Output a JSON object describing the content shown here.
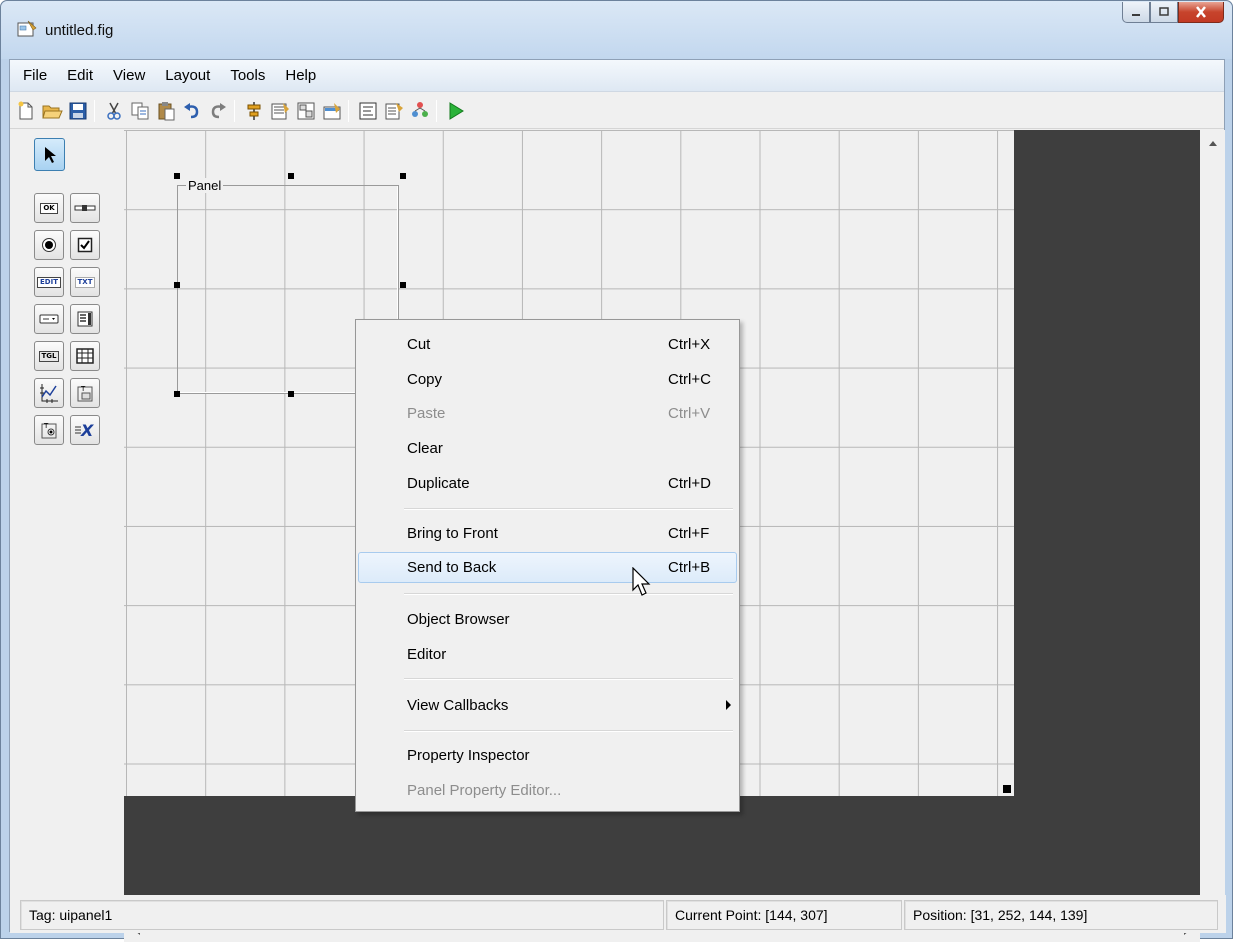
{
  "window": {
    "title": "untitled.fig",
    "controls": [
      "minimize-icon",
      "maximize-icon",
      "close-icon"
    ]
  },
  "menubar": {
    "items": [
      {
        "label": "File"
      },
      {
        "label": "Edit"
      },
      {
        "label": "View"
      },
      {
        "label": "Layout"
      },
      {
        "label": "Tools"
      },
      {
        "label": "Help"
      }
    ]
  },
  "toolbar": {
    "icons": [
      "new-figure-icon",
      "open-icon",
      "save-icon",
      "cut-icon",
      "copy-icon",
      "paste-icon",
      "undo-icon",
      "redo-icon",
      "align-objects-icon",
      "menu-editor-icon",
      "tab-order-editor-icon",
      "toolbar-editor-icon",
      "editor-icon",
      "property-inspector-icon",
      "object-browser-icon",
      "run-figure-icon"
    ]
  },
  "palette": {
    "items": [
      {
        "name": "select-tool",
        "icon": "arrow-pointer-icon",
        "text": ""
      },
      {
        "name": "push-button-tool",
        "icon": "push-button-icon",
        "text": "OK"
      },
      {
        "name": "slider-tool",
        "icon": "slider-icon",
        "text": ""
      },
      {
        "name": "radio-button-tool",
        "icon": "radio-button-icon",
        "text": ""
      },
      {
        "name": "check-box-tool",
        "icon": "check-box-icon",
        "text": ""
      },
      {
        "name": "edit-text-tool",
        "icon": "edit-text-icon",
        "text": "EDIT"
      },
      {
        "name": "static-text-tool",
        "icon": "static-text-icon",
        "text": "TXT"
      },
      {
        "name": "pop-up-menu-tool",
        "icon": "popup-menu-icon",
        "text": ""
      },
      {
        "name": "list-box-tool",
        "icon": "list-box-icon",
        "text": ""
      },
      {
        "name": "toggle-button-tool",
        "icon": "toggle-button-icon",
        "text": "TGL"
      },
      {
        "name": "table-tool",
        "icon": "table-icon",
        "text": ""
      },
      {
        "name": "axes-tool",
        "icon": "axes-icon",
        "text": ""
      },
      {
        "name": "panel-tool",
        "icon": "panel-icon",
        "text": ""
      },
      {
        "name": "button-group-tool",
        "icon": "button-group-icon",
        "text": ""
      },
      {
        "name": "activex-control-tool",
        "icon": "activex-icon",
        "text": "X"
      }
    ]
  },
  "canvas": {
    "panel_label": "Panel"
  },
  "context_menu": {
    "items": [
      {
        "label": "Cut",
        "shortcut": "Ctrl+X",
        "enabled": true
      },
      {
        "label": "Copy",
        "shortcut": "Ctrl+C",
        "enabled": true
      },
      {
        "label": "Paste",
        "shortcut": "Ctrl+V",
        "enabled": false
      },
      {
        "label": "Clear",
        "shortcut": "",
        "enabled": true
      },
      {
        "label": "Duplicate",
        "shortcut": "Ctrl+D",
        "enabled": true
      },
      {
        "label": "Bring to Front",
        "shortcut": "Ctrl+F",
        "enabled": true
      },
      {
        "label": "Send to Back",
        "shortcut": "Ctrl+B",
        "enabled": true,
        "highlighted": true
      },
      {
        "label": "Object Browser",
        "shortcut": "",
        "enabled": true
      },
      {
        "label": "Editor",
        "shortcut": "",
        "enabled": true
      },
      {
        "label": "View Callbacks",
        "shortcut": "",
        "enabled": true,
        "submenu": true
      },
      {
        "label": "Property Inspector",
        "shortcut": "",
        "enabled": true
      },
      {
        "label": "Panel Property Editor...",
        "shortcut": "",
        "enabled": false
      }
    ]
  },
  "statusbar": {
    "tag": "Tag: uipanel1",
    "current_point": "Current Point:  [144, 307]",
    "position": "Position: [31, 252, 144, 139]"
  },
  "colors": {
    "canvas_background": "#3e3e3e",
    "grid_line": "#b7b7b7",
    "run_icon": "#2bb33a",
    "menu_highlight": "#dcebfa"
  }
}
